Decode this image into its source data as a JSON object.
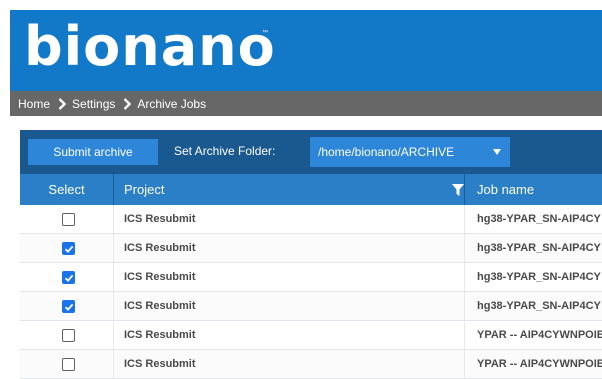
{
  "header": {
    "logo_text": "bionano",
    "logo_tm": "™"
  },
  "breadcrumb": {
    "items": [
      "Home",
      "Settings",
      "Archive Jobs"
    ]
  },
  "toolbar": {
    "submit_label": "Submit archive",
    "folder_label": "Set Archive Folder:",
    "folder_value": "/home/bionano/ARCHIVE"
  },
  "grid": {
    "columns": {
      "select": "Select",
      "project": "Project",
      "job_name": "Job name"
    },
    "rows": [
      {
        "checked": false,
        "project": "ICS Resubmit",
        "job_name": "hg38-YPAR_SN-AIP4CY"
      },
      {
        "checked": true,
        "project": "ICS Resubmit",
        "job_name": "hg38-YPAR_SN-AIP4CY"
      },
      {
        "checked": true,
        "project": "ICS Resubmit",
        "job_name": "hg38-YPAR_SN-AIP4CY"
      },
      {
        "checked": true,
        "project": "ICS Resubmit",
        "job_name": "hg38-YPAR_SN-AIP4CY"
      },
      {
        "checked": false,
        "project": "ICS Resubmit",
        "job_name": "YPAR -- AIP4CYWNPOIE"
      },
      {
        "checked": false,
        "project": "ICS Resubmit",
        "job_name": "YPAR -- AIP4CYWNPOIE"
      }
    ]
  },
  "icons": {
    "breadcrumb_separator": "chevron-right-icon",
    "dropdown": "caret-down-icon",
    "filter": "filter-icon",
    "checkbox_checked": "checkmark-icon"
  },
  "colors": {
    "brand_blue": "#1279c8",
    "breadcrumb_gray": "#676767",
    "toolbar_navy": "#1a5990",
    "button_blue": "#2d86d8",
    "grid_header_blue": "#2a7fc7",
    "checkbox_blue": "#1a73e8"
  }
}
